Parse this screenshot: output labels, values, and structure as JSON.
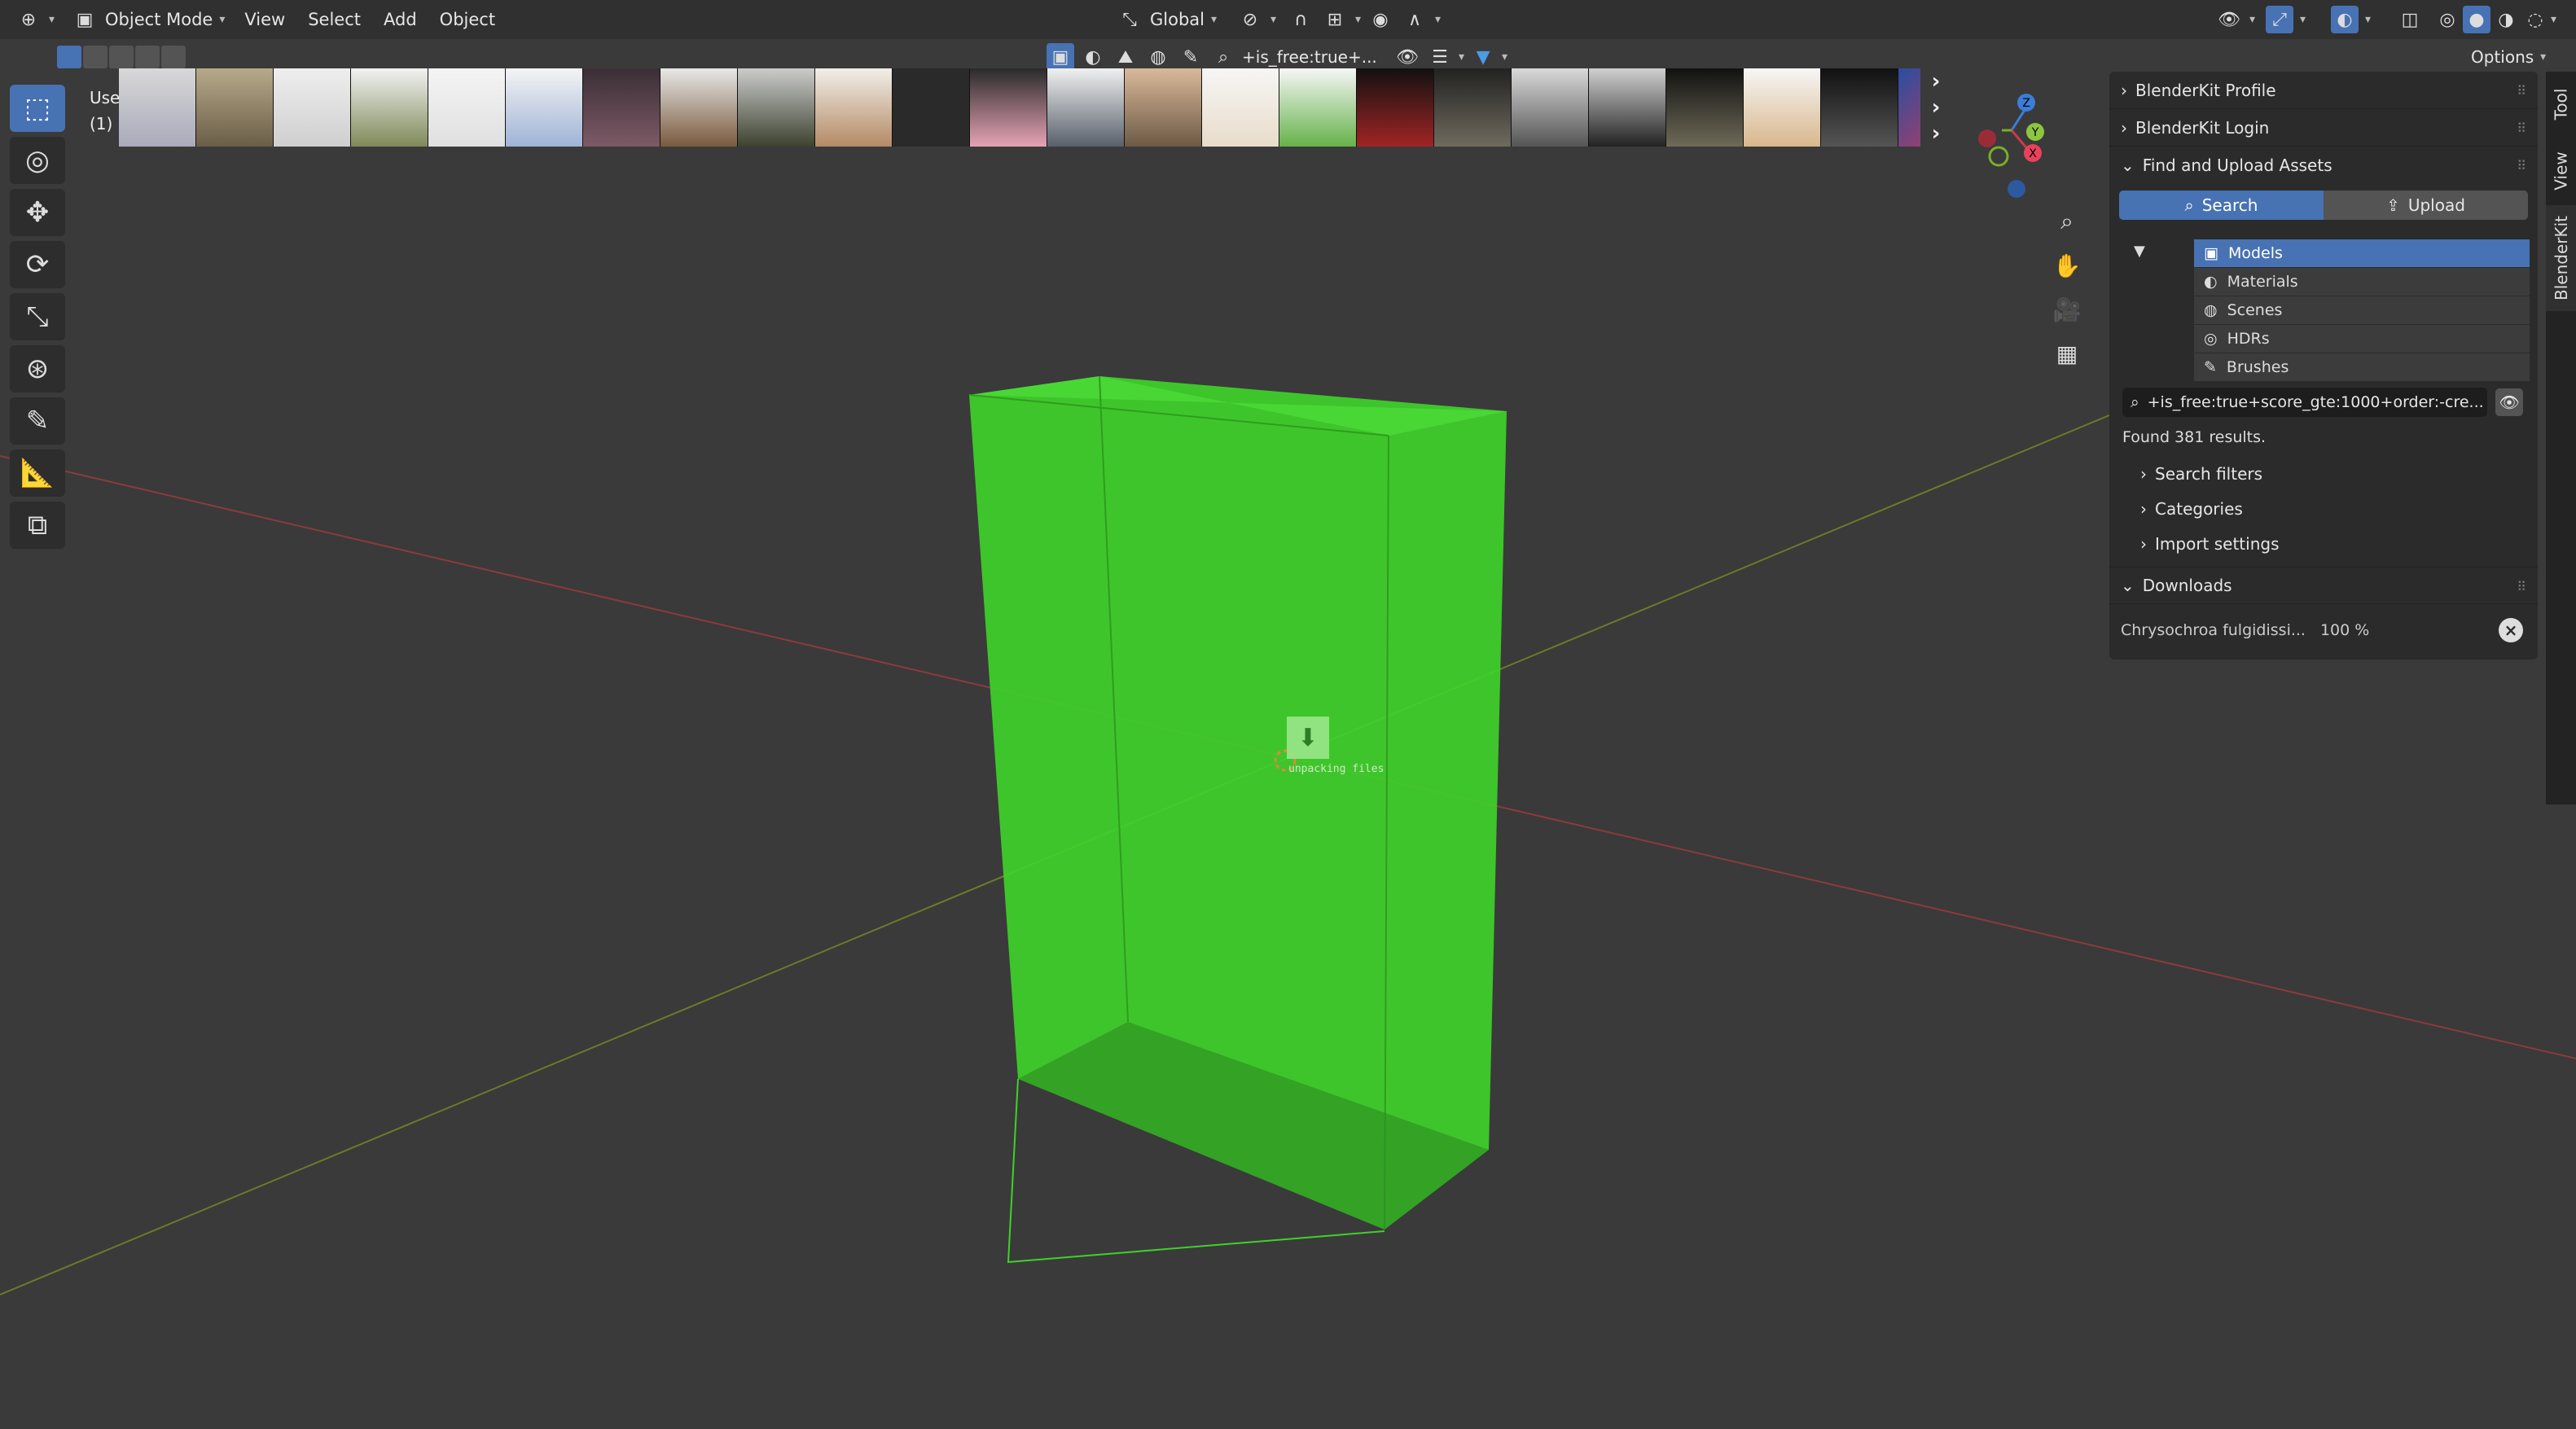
{
  "header": {
    "editor_icon": "viewport-icon",
    "mode": "Object Mode",
    "menus": [
      "View",
      "Select",
      "Add",
      "Object"
    ],
    "transform_orientation": "Global",
    "options_label": "Options"
  },
  "viewport_overlay": {
    "view_label": "Use",
    "collection_label": "(1)",
    "search_query_short": "+is_free:true+...",
    "unpacking_label": "unpacking files"
  },
  "asset_strip": {
    "thumbnails": [
      "vehicle-rover-thumbnail",
      "vintage-car-thumbnail",
      "rabbit-thumbnail",
      "tank-thumbnail",
      "goat-thumbnail",
      "satellite-thumbnail",
      "knight-character-thumbnail",
      "bear-thumbnail",
      "soldier-thumbnail",
      "chair-thumbnail",
      "empty-thumbnail",
      "anime-girl-thumbnail",
      "temple-thumbnail",
      "cartoon-boy-thumbnail",
      "dog-thumbnail",
      "grasshopper-thumbnail",
      "sports-car-night-thumbnail",
      "rock-thumbnail",
      "couch-thumbnail",
      "electronics-thumbnail",
      "stone-block-thumbnail",
      "bulldog-thumbnail",
      "car-dark-thumbnail",
      "pattern-thumbnail"
    ]
  },
  "right_panel": {
    "sections": {
      "profile": "BlenderKit Profile",
      "login": "BlenderKit Login",
      "find_upload": "Find and Upload Assets",
      "downloads": "Downloads"
    },
    "tabs": {
      "search": "Search",
      "upload": "Upload"
    },
    "asset_types": [
      {
        "label": "Models",
        "icon": "cube-icon",
        "selected": true
      },
      {
        "label": "Materials",
        "icon": "material-sphere-icon",
        "selected": false
      },
      {
        "label": "Scenes",
        "icon": "scene-icon",
        "selected": false
      },
      {
        "label": "HDRs",
        "icon": "world-icon",
        "selected": false
      },
      {
        "label": "Brushes",
        "icon": "brush-icon",
        "selected": false
      }
    ],
    "search_value": "+is_free:true+score_gte:1000+order:-cre...",
    "found_results": "Found 381 results.",
    "subsections": [
      "Search filters",
      "Categories",
      "Import settings"
    ],
    "download_item": {
      "name": "Chrysochroa fulgidissi...",
      "progress": "100 %"
    }
  },
  "side_tabs": [
    "Tool",
    "View",
    "BlenderKit"
  ],
  "gizmo": {
    "x": "X",
    "y": "Y",
    "z": "Z"
  },
  "colors": {
    "accent": "#4772b3",
    "viewport_bg": "#3a3a3a",
    "selection_green": "#3fd12a",
    "axis_x": "#c93b47",
    "axis_y": "#7bad2a",
    "axis_z": "#3b7dd8"
  }
}
